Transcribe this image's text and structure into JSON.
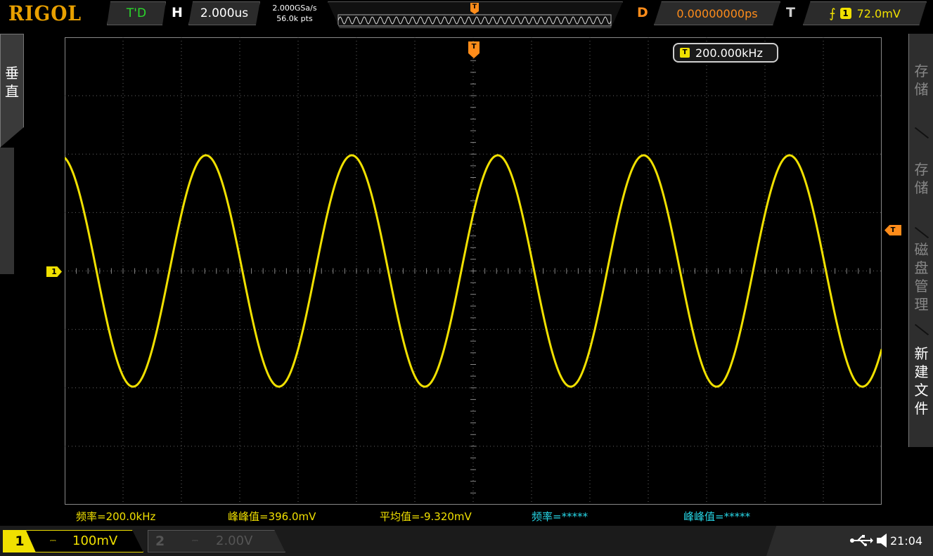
{
  "brand": "RIGOL",
  "top_bar": {
    "run_state": "T'D",
    "horizontal": {
      "label": "H",
      "value": "2.000us"
    },
    "sample_rate": "2.000GSa/s",
    "memory_depth": "56.0k pts",
    "delay": {
      "label": "D",
      "value": "0.00000000ps"
    },
    "trigger": {
      "label": "T",
      "channel": "1",
      "level": "72.0mV"
    }
  },
  "left_menu": {
    "label": "垂直"
  },
  "right_menu": {
    "items": [
      {
        "label": "存储",
        "active": false
      },
      {
        "label": "存储",
        "active": false
      },
      {
        "label": "磁盘管理",
        "active": false
      },
      {
        "label": "新建文件",
        "active": true
      }
    ]
  },
  "markers": {
    "trigger_marker": "T",
    "channel_marker": "1"
  },
  "frequency_counter": {
    "badge": "T",
    "value": "200.000kHz"
  },
  "waveform": {
    "channel": 1,
    "frequency_khz": 200,
    "peak_to_peak_mv": 396.0,
    "volts_per_div_mv": 100,
    "time_per_div_us": 2.0,
    "color": "#f0e000"
  },
  "measurements": [
    {
      "text": "频率=200.0kHz",
      "color": "yellow"
    },
    {
      "text": "峰峰值=396.0mV",
      "color": "yellow"
    },
    {
      "text": "平均值=-9.320mV",
      "color": "yellow"
    },
    {
      "text": "频率=*****",
      "color": "cyan"
    },
    {
      "text": "峰峰值=*****",
      "color": "cyan"
    }
  ],
  "bottom_bar": {
    "ch1": {
      "number": "1",
      "coupling": "⎓",
      "scale": "100mV"
    },
    "ch2": {
      "number": "2",
      "coupling": "⎓",
      "scale": "2.00V"
    },
    "time": "21:04"
  },
  "colors": {
    "accent": "#e8a000",
    "ch1": "#f0e000",
    "trigger": "#ff8c1a",
    "measure2": "#27d8e8",
    "run": "#2bd62b"
  }
}
